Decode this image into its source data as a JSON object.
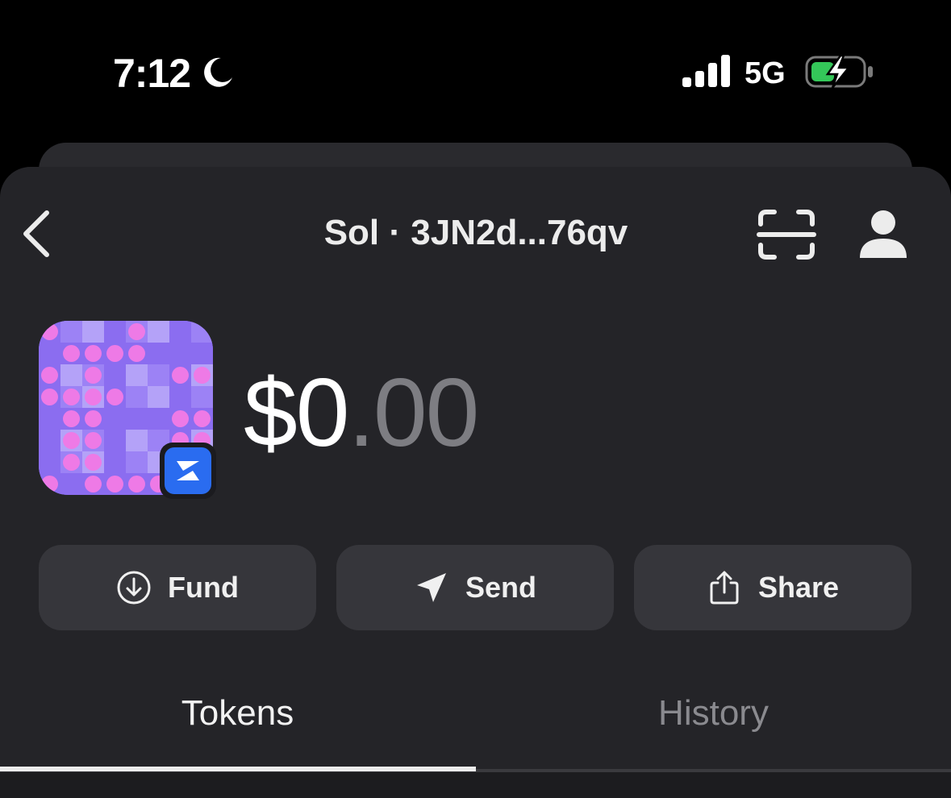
{
  "status_bar": {
    "time": "7:12",
    "network": "5G",
    "icons": [
      "moon-icon",
      "signal-icon",
      "battery-charging-icon"
    ],
    "battery_color": "#34c759"
  },
  "header": {
    "title": "Sol · 3JN2d...76qv",
    "back_icon": "chevron-left-icon",
    "scan_icon": "scan-icon",
    "profile_icon": "person-icon"
  },
  "wallet": {
    "balance_whole": "$0",
    "balance_cents": ".00",
    "avatar_colors": {
      "base": "#8b6df0",
      "light": "#b4a2f8",
      "mid": "#9c82f5",
      "dot": "#ee7ae6"
    },
    "badge_color": "#2a6cf0"
  },
  "actions": [
    {
      "label": "Fund",
      "icon": "arrow-down-circle-icon"
    },
    {
      "label": "Send",
      "icon": "paper-plane-icon"
    },
    {
      "label": "Share",
      "icon": "share-icon"
    }
  ],
  "tabs": [
    {
      "label": "Tokens",
      "active": true
    },
    {
      "label": "History",
      "active": false
    }
  ],
  "colors": {
    "background": "#000000",
    "sheet": "#242428",
    "button": "#36363b",
    "muted_text": "#7d7d82"
  }
}
